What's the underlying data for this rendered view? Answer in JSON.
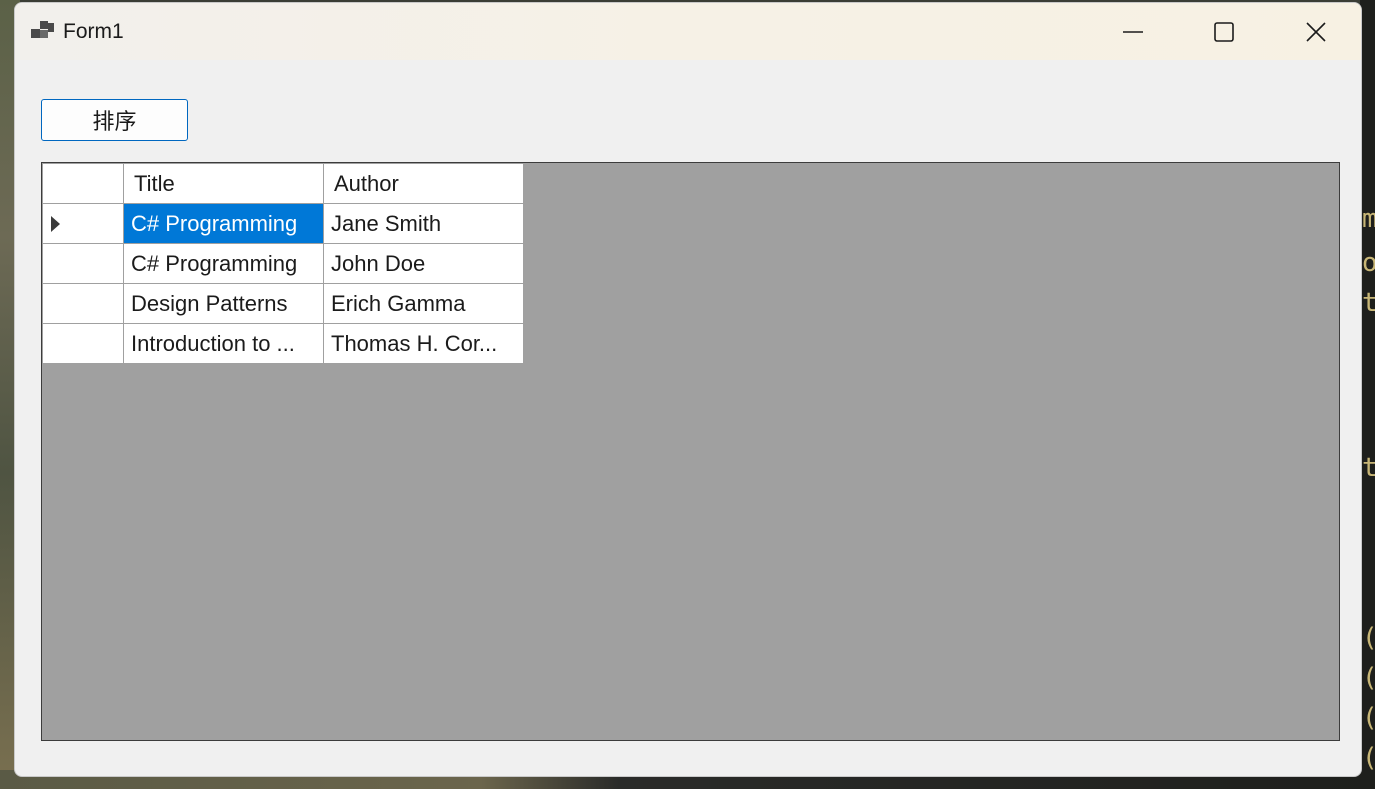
{
  "window": {
    "title": "Form1",
    "accent_color": "#0078d7"
  },
  "toolbar": {
    "sort_label": "排序"
  },
  "grid": {
    "columns": [
      "Title",
      "Author"
    ],
    "rows": [
      {
        "title": "C# Programming",
        "author": "Jane Smith",
        "selected": true
      },
      {
        "title": "C# Programming",
        "author": "John Doe",
        "selected": false
      },
      {
        "title": "Design Patterns",
        "author": "Erich Gamma",
        "selected": false
      },
      {
        "title": "Introduction to ...",
        "author": "Thomas H. Cor...",
        "selected": false
      }
    ]
  },
  "icons": [
    "app-icon",
    "minimize-icon",
    "maximize-icon",
    "close-icon",
    "current-row-indicator-icon"
  ]
}
